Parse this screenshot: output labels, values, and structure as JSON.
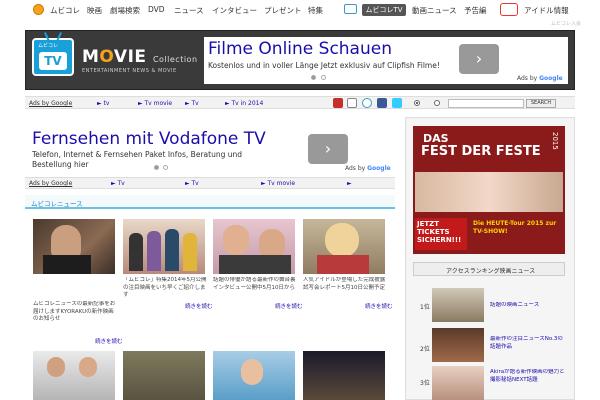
{
  "nav": {
    "items": [
      "ムビコレ",
      "映画",
      "劇場検索",
      "DVD",
      "ニュース",
      "インタビュー",
      "プレゼント",
      "特集"
    ],
    "tv_tab": "ムビコレTV",
    "right_items": [
      "動画ニュース",
      "予告編",
      "アイドル情報"
    ],
    "small_right": "ムビコレ入会"
  },
  "header": {
    "logo_small": "ムビコレ",
    "logo_tv": "TV",
    "title_m": "M",
    "title_o": "O",
    "title_rest": "VIE",
    "title_collection": "Collection",
    "tagline": "ENTERTAINMENT NEWS & MOVIE"
  },
  "ad_top": {
    "title": "Filme Online Schauen",
    "desc": "Kostenlos und in voller Länge Jetzt exklusiv auf Clipfish Filme!",
    "arrow": "›",
    "ads_by_prefix": "Ads by ",
    "ads_by_brand": "Google"
  },
  "linkbar1": {
    "ads": "Ads by Google",
    "links": [
      "► tv",
      "► Tv movie",
      "► Tv",
      "► Tv in 2014"
    ],
    "search_button": "SEARCH"
  },
  "ad_mid": {
    "title": "Fernsehen mit Vodafone TV",
    "desc": "Telefon, Internet & Fernsehen Paket Infos, Beratung und Bestellung hier",
    "arrow": "›",
    "ads_by_prefix": "Ads by ",
    "ads_by_brand": "Google"
  },
  "linkbar2": {
    "ads": "Ads by Google",
    "links": [
      "► Tv",
      "► Tv",
      "► Tv movie",
      "► "
    ]
  },
  "section": {
    "title": "ムビコレニュース"
  },
  "news": [
    {
      "caption": "ムビコレニュースの最新記事をお届けしますKYORAKUの新作映画のお知らせ",
      "more": "続きを読む"
    },
    {
      "caption": "「ムビコレ」特集2014年5月公開の注目映画をいち早くご紹介します",
      "more": "続きを読む"
    },
    {
      "caption": "話題の俳優が語る最新作の舞台裏インタビュー公開中5月10日から",
      "more": "続きを読む"
    },
    {
      "caption": "人気アイドルが登場した完成披露試写会レポート5月10日公開予定",
      "more": "続きを読む"
    }
  ],
  "banner": {
    "line1": "DAS",
    "line2": "FEST DER FESTE",
    "year": "2015",
    "cta": "JETZT TICKETS SICHERN!!!",
    "tour": "Die HEUTE-Tour 2015 zur TV-SHOW!"
  },
  "ranking": {
    "title": "アクセスランキング映画ニュース",
    "items": [
      {
        "no": "1位",
        "text": "話題の映画ニュース"
      },
      {
        "no": "2位",
        "text": "最新作の注目ニュースNo.3の話題作品"
      },
      {
        "no": "3位",
        "text": "Akiraが語る新作映画の魅力と撮影秘話NEXT話題"
      }
    ]
  }
}
